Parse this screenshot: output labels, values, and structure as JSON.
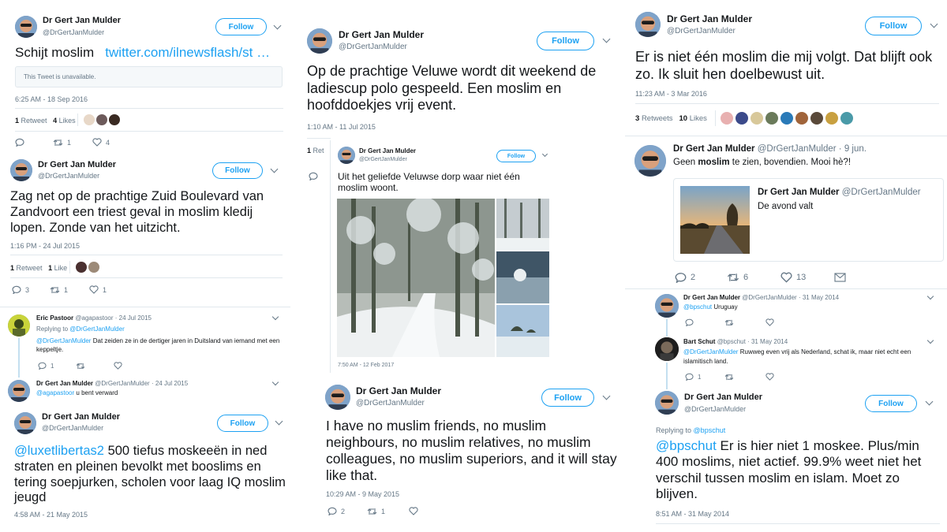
{
  "author": {
    "name": "Dr Gert Jan Mulder",
    "handle": "@DrGertJanMulder",
    "handle_dated": "@DrGertJanMulder · 9 jun."
  },
  "follow_label": "Follow",
  "col1": {
    "t1": {
      "text": "Schijt moslim",
      "link": "twitter.com/ilnewsflash/st …",
      "quoted": "This Tweet is unavailable.",
      "time": "6:25 AM - 18 Sep 2016",
      "retweets_n": "1",
      "retweets_l": "Retweet",
      "likes_n": "4",
      "likes_l": "Likes",
      "reply_count": "",
      "rt_count": "1",
      "like_count": "4"
    },
    "t2": {
      "text": "Zag net op de prachtige Zuid Boulevard van Zandvoort een triest geval in moslim kledij lopen. Zonde van het uitzicht.",
      "time": "1:16 PM - 24 Jul 2015",
      "retweets_n": "1",
      "retweets_l": "Retweet",
      "likes_n": "1",
      "likes_l": "Like",
      "reply_count": "3",
      "rt_count": "1",
      "like_count": "1"
    },
    "reply1": {
      "name": "Eric Pastoor",
      "handle": "@agapastoor · 24 Jul 2015",
      "replying": "Replying to",
      "replying_to": "@DrGertJanMulder",
      "mention": "@DrGertJanMulder",
      "text": "Dat zeiden ze in de dertiger jaren in Duitsland van iemand met een keppeltje.",
      "reply_count": "1"
    },
    "reply2": {
      "handle": "@DrGertJanMulder · 24 Jul 2015",
      "mention": "@agapastoor",
      "text": "u bent verward"
    },
    "t3": {
      "mention": "@luxetlibertas2",
      "text": "500  tiefus moskeeën in ned straten en pleinen bevolkt met booslims en tering soepjurken, scholen voor laag IQ moslim jeugd",
      "time": "4:58 AM - 21 May 2015"
    }
  },
  "col2": {
    "t1": {
      "text": "Op de prachtige Veluwe wordt dit weekend de ladiescup polo gespeeld. Een moslim en hoofddoekjes vrij event.",
      "time": "1:10 AM - 11 Jul 2015",
      "retweets_l": "Ret"
    },
    "quote": {
      "text": "Uit het geliefde Veluwse dorp waar niet één moslim woont.",
      "time": "7:50 AM - 12 Feb 2017"
    },
    "t2": {
      "text": "I have no muslim friends, no muslim neighbours, no muslim relatives, no muslim colleagues, no muslim superiors, and it will stay like that.",
      "time": "10:29 AM - 9 May 2015",
      "reply_count": "2",
      "rt_count": "1"
    }
  },
  "col3": {
    "t1": {
      "text": "Er is niet één moslim die mij volgt. Dat blijft ook zo. Ik sluit hen doelbewust uit.",
      "time": "11:23 AM - 3 Mar 2016",
      "retweets_n": "3",
      "retweets_l": "Retweets",
      "likes_n": "10",
      "likes_l": "Likes"
    },
    "t2": {
      "text_pre": "Geen ",
      "text_bold": "moslim",
      "text_post": " te zien, bovendien. Mooi hè?!",
      "quote_name": "Dr Gert Jan Mulder",
      "quote_handle": "@DrGertJanMulder",
      "quote_text": "De avond valt",
      "reply_count": "2",
      "rt_count": "6",
      "like_count": "13"
    },
    "reply1": {
      "handle": "@DrGertJanMulder · 31 May 2014",
      "mention": "@bpschut",
      "text": "Uruguay"
    },
    "reply2": {
      "name": "Bart Schut",
      "handle": "@bpschut · 31 May 2014",
      "mention": "@DrGertJanMulder",
      "text": "Ruwweg even vrij als Nederland, schat ik, maar niet echt een islamitisch land.",
      "reply_count": "1"
    },
    "t3": {
      "replying": "Replying to",
      "replying_to": "@bpschut",
      "mention": "@bpschut",
      "text": "Er is hier niet 1 moskee. Plus/min 400 moslims, niet actief. 99.9% weet niet het verschil tussen moslim en islam. Moet zo blijven.",
      "time": "8:51 AM - 31 May 2014"
    }
  },
  "colors": {
    "accent": "#1da1f2",
    "text": "#14171a",
    "muted": "#657786",
    "border": "#e1e8ed"
  }
}
